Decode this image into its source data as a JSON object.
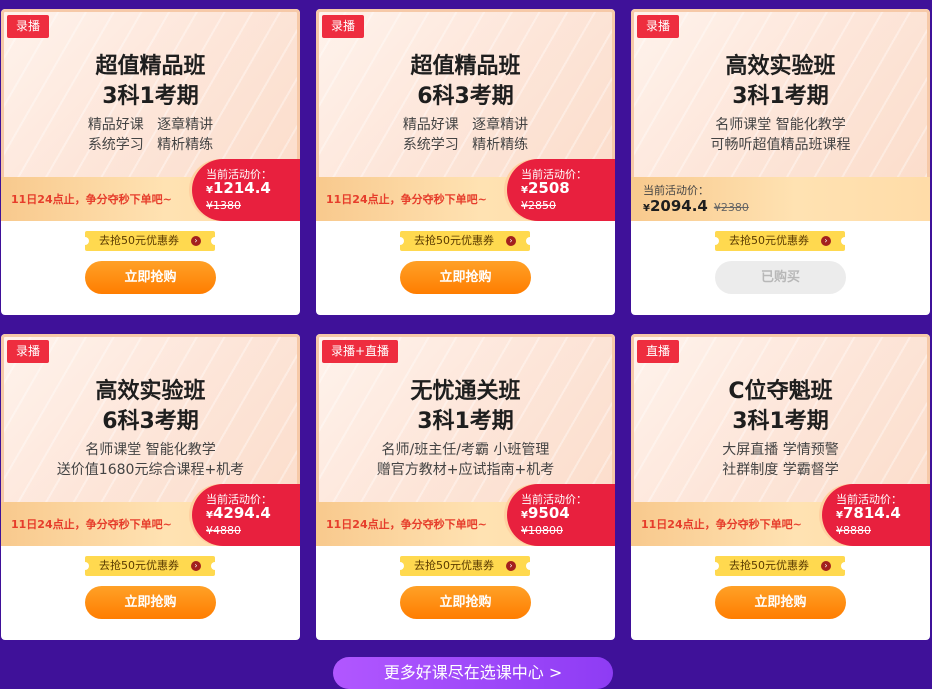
{
  "cards": [
    {
      "tag": "录播",
      "title1": "超值精品班",
      "title2": "3科1考期",
      "desc1": "精品好课   逐章精讲",
      "desc2": "系统学习   精析精练",
      "promo": "11日24点止，争分夺秒下单吧~",
      "price_label": "当前活动价：",
      "yen": "¥",
      "price": "1214.4",
      "old_price": "¥1380",
      "coupon": "去抢50元优惠券",
      "button": "立即抢购",
      "purchased": false
    },
    {
      "tag": "录播",
      "title1": "超值精品班",
      "title2": "6科3考期",
      "desc1": "精品好课   逐章精讲",
      "desc2": "系统学习   精析精练",
      "promo": "11日24点止，争分夺秒下单吧~",
      "price_label": "当前活动价：",
      "yen": "¥",
      "price": "2508",
      "old_price": "¥2850",
      "coupon": "去抢50元优惠券",
      "button": "立即抢购",
      "purchased": false
    },
    {
      "tag": "录播",
      "title1": "高效实验班",
      "title2": "3科1考期",
      "desc1": "名师课堂 智能化教学",
      "desc2": "可畅听超值精品班课程",
      "promo": "",
      "price_label": "当前活动价：",
      "yen": "¥",
      "price": "2094.4",
      "old_price": "¥2380",
      "coupon": "去抢50元优惠券",
      "button": "已购买",
      "purchased": true
    },
    {
      "tag": "录播",
      "title1": "高效实验班",
      "title2": "6科3考期",
      "desc1": "名师课堂 智能化教学",
      "desc2": "送价值1680元综合课程+机考",
      "promo": "11日24点止，争分夺秒下单吧~",
      "price_label": "当前活动价：",
      "yen": "¥",
      "price": "4294.4",
      "old_price": "¥4880",
      "coupon": "去抢50元优惠券",
      "button": "立即抢购",
      "purchased": false
    },
    {
      "tag": "录播+直播",
      "title1": "无忧通关班",
      "title2": "3科1考期",
      "desc1": "名师/班主任/考霸 小班管理",
      "desc2": "赠官方教材+应试指南+机考",
      "promo": "11日24点止，争分夺秒下单吧~",
      "price_label": "当前活动价：",
      "yen": "¥",
      "price": "9504",
      "old_price": "¥10800",
      "coupon": "去抢50元优惠券",
      "button": "立即抢购",
      "purchased": false
    },
    {
      "tag": "直播",
      "title1": "C位夺魁班",
      "title2": "3科1考期",
      "desc1": "大屏直播 学情预警",
      "desc2": "社群制度 学霸督学",
      "promo": "11日24点止，争分夺秒下单吧~",
      "price_label": "当前活动价：",
      "yen": "¥",
      "price": "7814.4",
      "old_price": "¥8880",
      "coupon": "去抢50元优惠券",
      "button": "立即抢购",
      "purchased": false
    }
  ],
  "more_button": "更多好课尽在选课中心 >",
  "colors": {
    "background": "#3f1199",
    "tag": "#ee2d3f",
    "price_box": "#e8203e",
    "buy_button": "#ff8c10",
    "more_button": "#9d47fa"
  }
}
